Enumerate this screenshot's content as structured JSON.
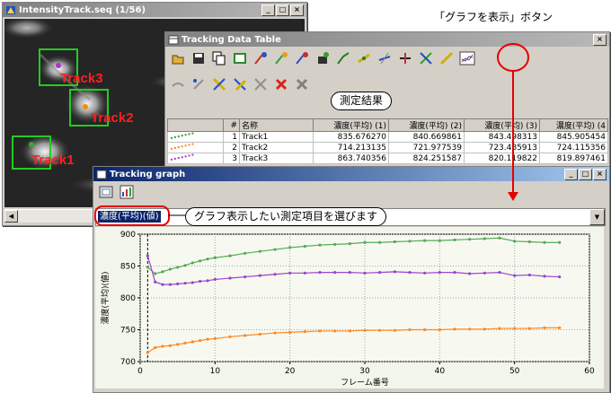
{
  "annotations": {
    "graph_button_callout": "「グラフを表示」ボタン",
    "results_callout": "測定結果",
    "select_callout": "グラフ表示したい測定項目を選びます",
    "accent_red": "#e60000"
  },
  "intensity_window": {
    "title": "IntensityTrack.seq (1/56)",
    "tracks": [
      {
        "label": "Track3",
        "color": "#ff2020"
      },
      {
        "label": "Track2",
        "color": "#ff2020"
      },
      {
        "label": "Track1",
        "color": "#ff2020"
      }
    ],
    "box_color": "#22cc22"
  },
  "table_window": {
    "title": "Tracking Data Table",
    "columns": [
      "#",
      "名称",
      "濃度(平均) (1)",
      "濃度(平均) (2)",
      "濃度(平均) (3)",
      "濃度(平均) (4"
    ],
    "rows": [
      {
        "num": "1",
        "name": "Track1",
        "v1": "835.676270",
        "v2": "840.669861",
        "v3": "843.498313",
        "v4": "845.905454"
      },
      {
        "num": "2",
        "name": "Track2",
        "v1": "714.213135",
        "v2": "721.977539",
        "v3": "723.485913",
        "v4": "724.115356"
      },
      {
        "num": "3",
        "name": "Track3",
        "v1": "863.740356",
        "v2": "824.251587",
        "v3": "820.119822",
        "v4": "819.897461"
      }
    ]
  },
  "graph_window": {
    "title": "Tracking graph",
    "selected_item": "濃度(平均)(値)"
  },
  "chart_data": {
    "type": "line",
    "xlabel": "フレーム番号",
    "ylabel": "濃度(平均)(値)",
    "xlim": [
      0,
      60
    ],
    "ylim": [
      700,
      900
    ],
    "xticks": [
      "0",
      "10",
      "20",
      "30",
      "40",
      "50",
      "60"
    ],
    "yticks": [
      "700",
      "750",
      "800",
      "850",
      "900"
    ],
    "grid": true,
    "series": [
      {
        "color": "#55aa55",
        "x": [
          1,
          2,
          3,
          4,
          5,
          6,
          7,
          8,
          9,
          10,
          12,
          14,
          16,
          18,
          20,
          22,
          24,
          26,
          28,
          30,
          32,
          34,
          36,
          38,
          40,
          42,
          44,
          46,
          48,
          50,
          52,
          54,
          56
        ],
        "values": [
          848,
          838,
          841,
          845,
          848,
          851,
          855,
          858,
          861,
          863,
          866,
          870,
          873,
          876,
          879,
          881,
          883,
          884,
          885,
          887,
          887,
          888,
          889,
          890,
          890,
          891,
          892,
          893,
          894,
          889,
          888,
          887,
          887
        ]
      },
      {
        "color": "#9a44cc",
        "x": [
          1,
          2,
          3,
          4,
          5,
          6,
          7,
          8,
          9,
          10,
          12,
          14,
          16,
          18,
          20,
          22,
          24,
          26,
          28,
          30,
          32,
          34,
          36,
          38,
          40,
          42,
          44,
          46,
          48,
          50,
          52,
          54,
          56
        ],
        "values": [
          866,
          825,
          821,
          821,
          822,
          823,
          824,
          826,
          827,
          829,
          831,
          833,
          835,
          837,
          839,
          839,
          840,
          840,
          840,
          839,
          840,
          841,
          840,
          839,
          840,
          840,
          838,
          839,
          840,
          835,
          836,
          834,
          833
        ]
      },
      {
        "color": "#ff8822",
        "x": [
          1,
          2,
          3,
          4,
          5,
          6,
          7,
          8,
          9,
          10,
          12,
          14,
          16,
          18,
          20,
          22,
          24,
          26,
          28,
          30,
          32,
          34,
          36,
          38,
          40,
          42,
          44,
          46,
          48,
          50,
          52,
          54,
          56
        ],
        "values": [
          714,
          722,
          724,
          725,
          727,
          729,
          731,
          733,
          735,
          736,
          739,
          741,
          743,
          745,
          746,
          747,
          748,
          748,
          748,
          749,
          749,
          749,
          750,
          750,
          750,
          751,
          751,
          751,
          752,
          752,
          752,
          753,
          753
        ]
      }
    ]
  }
}
